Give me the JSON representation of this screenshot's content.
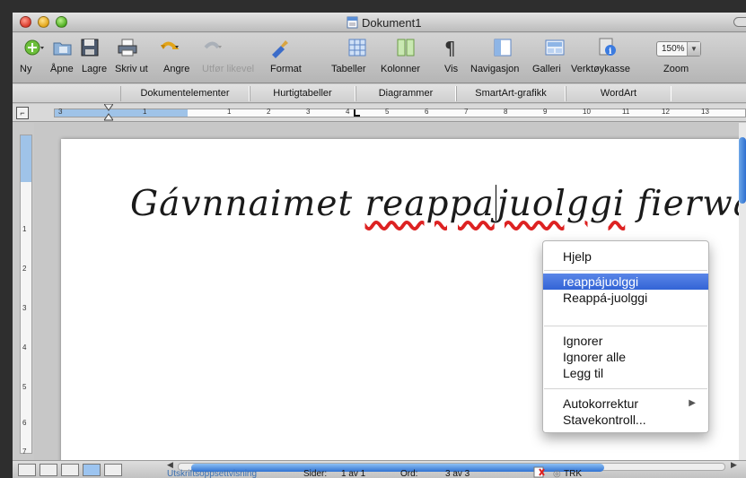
{
  "window": {
    "title": "Dokument1"
  },
  "toolbar": {
    "items": [
      {
        "label": "Ny"
      },
      {
        "label": "Åpne"
      },
      {
        "label": "Lagre"
      },
      {
        "label": "Skriv ut"
      },
      {
        "label": "Angre"
      },
      {
        "label": "Utfør likevel"
      },
      {
        "label": "Format"
      },
      {
        "label": "Tabeller"
      },
      {
        "label": "Kolonner"
      },
      {
        "label": "Vis"
      },
      {
        "label": "Navigasjon"
      },
      {
        "label": "Galleri"
      },
      {
        "label": "Verktøykasse"
      },
      {
        "label": "Zoom"
      }
    ],
    "zoom_value": "150%"
  },
  "gallery_tabs": [
    "Dokumentelementer",
    "Hurtigtabeller",
    "Diagrammer",
    "SmartArt-grafikk",
    "WordArt"
  ],
  "ruler": {
    "numbers": [
      "3",
      "1",
      "1",
      "2",
      "3",
      "4",
      "5",
      "6",
      "7",
      "8",
      "9",
      "10",
      "11",
      "12",
      "13"
    ]
  },
  "vruler": {
    "numbers": [
      "1",
      "2",
      "3",
      "4",
      "5",
      "6",
      "7"
    ]
  },
  "document": {
    "text_before": "Gávnnaimet ",
    "misspelled_part1": "reappa",
    "misspelled_part2": "juolggi",
    "text_after": " fierwás."
  },
  "context_menu": {
    "help": "Hjelp",
    "suggestions": [
      "reappájuolggi",
      "Reappá-juolggi"
    ],
    "ignore": "Ignorer",
    "ignore_all": "Ignorer alle",
    "add": "Legg til",
    "autocorrect": "Autokorrektur",
    "spellcheck": "Stavekontroll..."
  },
  "status": {
    "view": "Utskriftsoppsettvisning",
    "pages_label": "Sider:",
    "pages_value": "1 av 1",
    "words_label": "Ord:",
    "words_value": "3 av 3",
    "track": "TRK"
  },
  "colors": {
    "highlight": "#3364d6",
    "ruler_margin": "#9fc3e8",
    "squiggle": "#d22222"
  }
}
